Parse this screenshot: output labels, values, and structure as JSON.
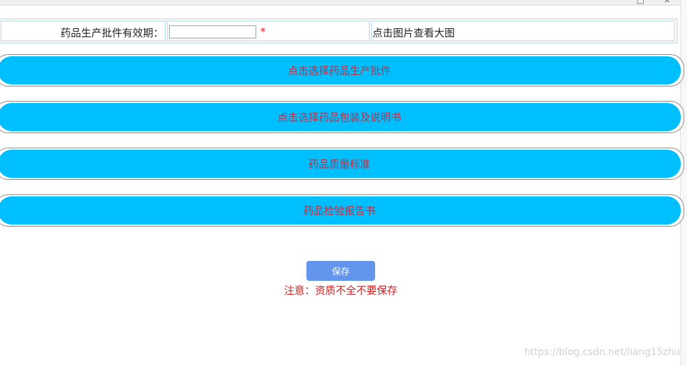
{
  "window": {
    "controls": [
      "□",
      "×"
    ]
  },
  "form": {
    "validity_label": "药品生产批件有效期：",
    "validity_value": "",
    "required_mark": "*",
    "view_hint": "点击图片查看大图"
  },
  "uploads": [
    {
      "label": "点击选择药品生产批件"
    },
    {
      "label": "点击选择药品包装及说明书"
    },
    {
      "label": "药品质量标准"
    },
    {
      "label": "药品检验报告书"
    }
  ],
  "actions": {
    "save_label": "保存",
    "notice": "注意：资质不全不要保存"
  },
  "watermark": "https://blog.csdn.net/liang15zhu",
  "colors": {
    "button_blue": "#00bfff",
    "button_text": "#b3344a",
    "save_blue": "#6495ed",
    "notice_red": "#d01a1a"
  }
}
